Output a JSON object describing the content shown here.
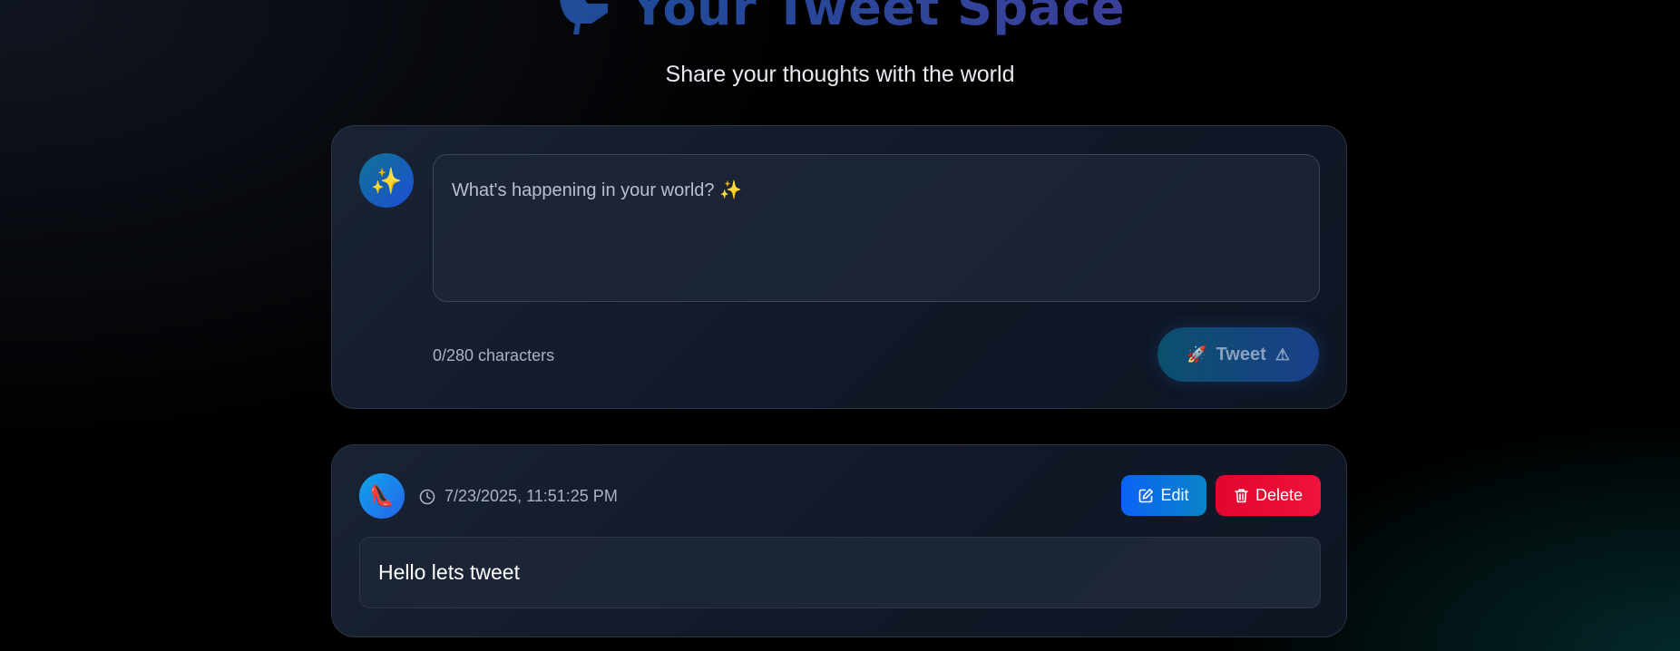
{
  "header": {
    "title": "Your Tweet Space",
    "subtitle": "Share your thoughts with the world",
    "logo_icon": "bird-icon"
  },
  "composer": {
    "avatar_emoji": "✨",
    "placeholder": "What's happening in your world? ✨",
    "value": "",
    "char_count": "0/280 characters",
    "tweet_button": {
      "icon": "🚀",
      "label": "Tweet",
      "warning_icon": "⚠"
    }
  },
  "tweets": [
    {
      "avatar_emoji": "👠",
      "timestamp": "7/23/2025, 11:51:25 PM",
      "edit_label": "Edit",
      "delete_label": "Delete",
      "content": "Hello lets tweet"
    }
  ],
  "colors": {
    "title_gradient_start": "#1f4b98",
    "title_gradient_end": "#3b3f9a",
    "edit_button": "#0b63f6",
    "delete_button": "#e0062d"
  }
}
